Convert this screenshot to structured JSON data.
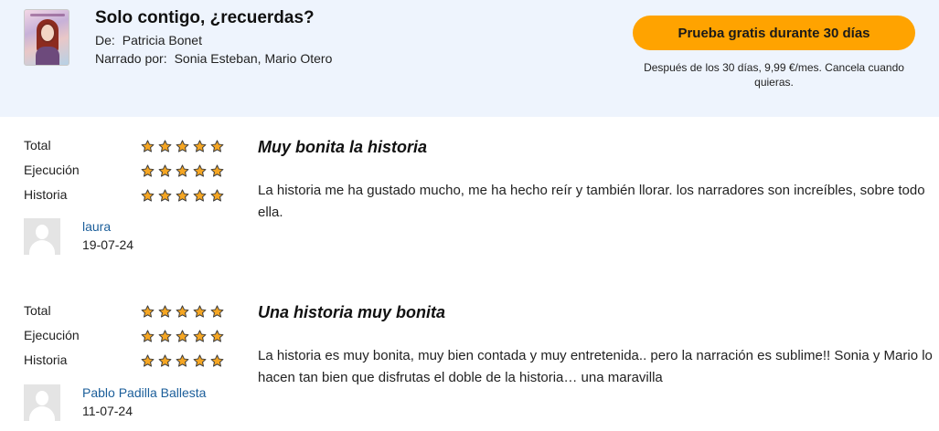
{
  "book": {
    "title": "Solo contigo, ¿recuerdas?",
    "author_label": "De:",
    "author": "Patricia Bonet",
    "narrator_label": "Narrado por:",
    "narrators": "Sonia Esteban, Mario Otero",
    "cta_label": "Prueba gratis durante 30 días",
    "cta_note": "Después de los 30 días, 9,99 €/mes. Cancela cuando quieras.",
    "cta_color": "#ffa300"
  },
  "reviews": [
    {
      "ratings": [
        {
          "label": "Total",
          "stars": 5
        },
        {
          "label": "Ejecución",
          "stars": 5
        },
        {
          "label": "Historia",
          "stars": 5
        }
      ],
      "author": "laura",
      "date": "19-07-24",
      "title": "Muy bonita la historia",
      "body": "La historia me ha gustado mucho, me ha hecho reír y también llorar. los narradores son increíbles, sobre todo ella."
    },
    {
      "ratings": [
        {
          "label": "Total",
          "stars": 5
        },
        {
          "label": "Ejecución",
          "stars": 5
        },
        {
          "label": "Historia",
          "stars": 5
        }
      ],
      "author": "Pablo Padilla Ballesta",
      "date": "11-07-24",
      "title": "Una historia muy bonita",
      "body": "La historia es muy bonita, muy bien contada y muy entretenida.. pero la narración es sublime!! Sonia y Mario lo hacen tan bien que disfrutas el doble de la historia… una maravilla"
    }
  ],
  "icons": {
    "star": "star-icon",
    "avatar": "user-silhouette-icon"
  },
  "colors": {
    "header_bg": "#eef4fd",
    "star_fill": "#f5a623",
    "author_link": "#1b5e9a"
  }
}
